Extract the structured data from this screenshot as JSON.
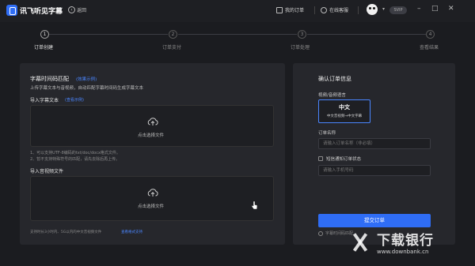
{
  "header": {
    "app_name": "讯飞听见字幕",
    "back_label": "返回",
    "my_orders_label": "我的订单",
    "support_label": "在线客服",
    "vip_label": "SVIP",
    "minimize": "–",
    "maximize": "□",
    "close": "✕"
  },
  "steps": [
    {
      "number": "1",
      "label": "订单创建"
    },
    {
      "number": "2",
      "label": "订单支付"
    },
    {
      "number": "3",
      "label": "订单处理"
    },
    {
      "number": "4",
      "label": "查看结果"
    }
  ],
  "left": {
    "title": "字幕时间码匹配",
    "title_link": "(效果示例)",
    "subtitle": "上传字幕文本与音视频，自动匹配字幕时间码生成字幕文本",
    "import_text_label": "导入字幕文本",
    "import_text_link": "(查看示例)",
    "upload_text_hint": "点击选择文件",
    "note_1": "1、可以支持UTF-8编码的txt/doc/docx格式文件。",
    "note_2": "2、暂不支持特殊符号的匹配，请先去除后再上传。",
    "import_av_label": "导入音视频文件",
    "upload_av_hint": "点击选择文件",
    "footer_note": "支持时长3小时内、5G以内的中文音视频文件",
    "footer_link": "查看格式支持"
  },
  "right": {
    "title": "确认订单信息",
    "lang_label": "视频/音频语言",
    "lang_value": "中文",
    "lang_desc": "中文音视频→中文字幕",
    "order_name_label": "订单名称",
    "order_name_placeholder": "请输入订单名称（非必填）",
    "sms_label": "短信通知订单状态",
    "phone_placeholder": "请输入手机号码",
    "submit_label": "提交订单",
    "agreement_text": "字幕时间码匹配"
  },
  "watermark": {
    "title": "下载银行",
    "url": "www.downbank.cn"
  },
  "colors": {
    "accent": "#2f6df5",
    "link": "#4a86ff",
    "background": "#1b1c20",
    "panel": "#26272c"
  }
}
